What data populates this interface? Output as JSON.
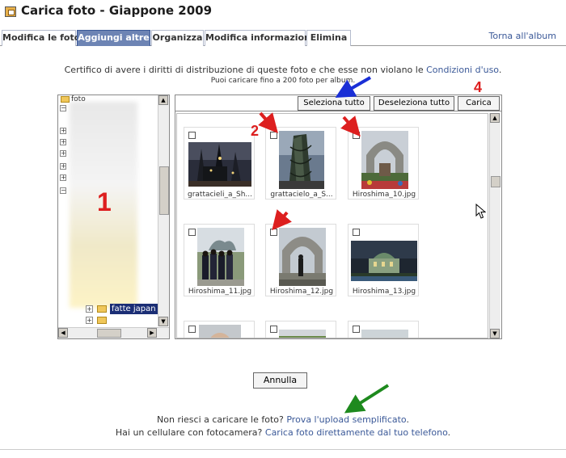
{
  "header": {
    "title": "Carica foto - Giappone 2009"
  },
  "tabs": [
    {
      "label": "Modifica le foto"
    },
    {
      "label": "Aggiungi altre"
    },
    {
      "label": "Organizza"
    },
    {
      "label": "Modifica informazioni"
    },
    {
      "label": "Elimina"
    }
  ],
  "back_link": "Torna all'album",
  "cert": {
    "text": "Certifico di avere i diritti di distribuzione di queste foto e che esse non violano le ",
    "link": "Condizioni d'uso",
    "end": "."
  },
  "limit_text": "Puoi caricare fino a 200 foto per album.",
  "tree": {
    "root_label": "foto",
    "selected_folder": "fatte japan"
  },
  "toolbar": {
    "select_all": "Seleziona tutto",
    "deselect_all": "Deseleziona tutto",
    "upload": "Carica"
  },
  "photos": [
    {
      "caption": "grattacieli_a_Sh..."
    },
    {
      "caption": "grattacielo_a_S..."
    },
    {
      "caption": "Hiroshima_10.jpg"
    },
    {
      "caption": "Hiroshima_11.jpg"
    },
    {
      "caption": "Hiroshima_12.jpg"
    },
    {
      "caption": "Hiroshima_13.jpg"
    }
  ],
  "annotations": {
    "n1": "1",
    "n2": "2",
    "n4": "4"
  },
  "cancel_label": "Annulla",
  "help": {
    "line1_text": "Non riesci a caricare le foto? ",
    "line1_link": "Prova l'upload semplificato",
    "line1_end": ".",
    "line2_text": "Hai un cellulare con fotocamera? ",
    "line2_link": "Carica foto direttamente dal tuo telefono",
    "line2_end": "."
  },
  "colors": {
    "accent": "#3b5998",
    "tab_active": "#6d84b4",
    "annotation_red": "#dd1f1f",
    "annotation_blue": "#1a2fd6",
    "annotation_green": "#1e8a1e"
  }
}
